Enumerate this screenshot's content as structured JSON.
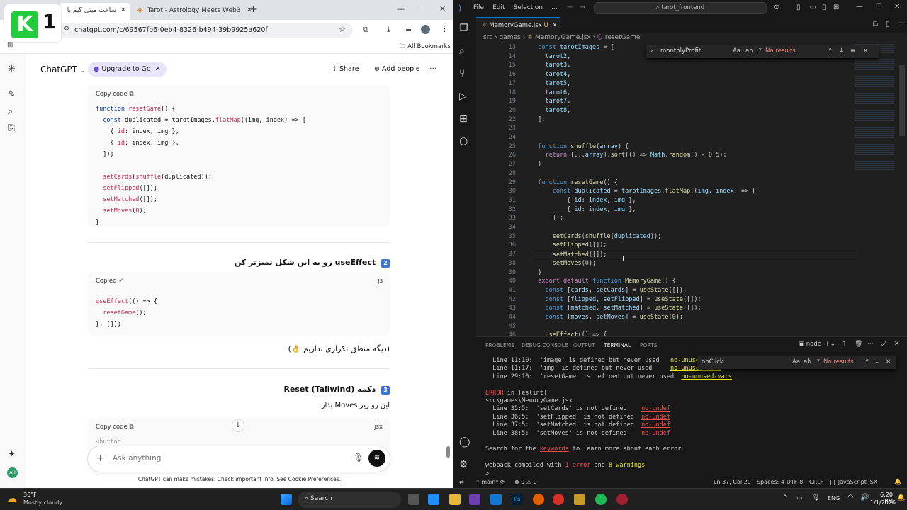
{
  "browser": {
    "tabs": [
      {
        "label": "ساخت میتی گیم با React"
      },
      {
        "label": "Tarot - Astrology Meets Web3"
      }
    ],
    "new_tab": "+",
    "url": "chatgpt.com/c/69567fb6-0eb4-8326-b494-39b9925a620f",
    "all_bookmarks": "All Bookmarks",
    "logo_text": "1"
  },
  "chatgpt": {
    "title": "ChatGPT",
    "upgrade": "Upgrade to Go",
    "share": "Share",
    "add_people": "Add people",
    "input_placeholder": "Ask anything",
    "disclaimer": "ChatGPT can make mistakes. Check important info. See",
    "disclaimer_link": "Cookie Preferences.",
    "code1": {
      "copy": "Copy code",
      "lines": [
        [
          "kw",
          "function "
        ],
        [
          "fn",
          "resetGame"
        ],
        [
          "",
          "() {"
        ],
        "br",
        [
          "",
          "  "
        ],
        [
          "kw",
          "const "
        ],
        [
          "",
          "duplicated = tarotImages."
        ],
        [
          "fn",
          "flatMap"
        ],
        [
          "",
          "((img, index) => ["
        ],
        "br",
        [
          "",
          "    { "
        ],
        [
          "str",
          "id"
        ],
        [
          "",
          ": index, img },"
        ],
        "br",
        [
          "",
          "    { "
        ],
        [
          "str",
          "id"
        ],
        [
          "",
          ": index, img },"
        ],
        "br",
        [
          "",
          "  ]);"
        ],
        "br",
        [
          "",
          ""
        ],
        "br",
        [
          "",
          "  "
        ],
        [
          "fn",
          "setCards"
        ],
        [
          "",
          "("
        ],
        [
          "fn",
          "shuffle"
        ],
        [
          "",
          "(duplicated));"
        ],
        "br",
        [
          "",
          "  "
        ],
        [
          "fn",
          "setFlipped"
        ],
        [
          "",
          "([]);"
        ],
        "br",
        [
          "",
          "  "
        ],
        [
          "fn",
          "setMatched"
        ],
        [
          "",
          "([]);"
        ],
        "br",
        [
          "",
          "  "
        ],
        [
          "fn",
          "setMoves"
        ],
        [
          "",
          "("
        ],
        [
          "str",
          "0"
        ],
        [
          "",
          ");"
        ],
        "br",
        [
          "",
          "}"
        ]
      ]
    },
    "heading2": "useEffect رو به این شکل تمیزتر کن",
    "badge2": "2",
    "code2": {
      "copy": "Copied ✓",
      "lang": "js",
      "lines": [
        [
          [
            "fn",
            "useEffect"
          ],
          [
            "",
            "(() => {"
          ]
        ],
        [
          [
            "",
            "  "
          ],
          [
            "fn",
            "resetGame"
          ],
          [
            "",
            "();"
          ]
        ],
        [
          [
            "",
            "}, []);"
          ]
        ]
      ]
    },
    "note": "(دیگه منطق تکراری نداریم 👌)",
    "heading3": "دکمه Reset (Tailwind)",
    "badge3": "3",
    "para3": "این رو زیر Moves بذار:",
    "code3": {
      "copy": "Copy code",
      "lang": "jsx",
      "peek": "<button"
    }
  },
  "vscode": {
    "menu": [
      "File",
      "Edit",
      "Selection",
      "..."
    ],
    "search": "tarot_frontend",
    "tab": "MemoryGame.jsx",
    "tab_status": "U",
    "breadcrumb": [
      "src",
      "games",
      "MemoryGame.jsx",
      "resetGame"
    ],
    "find1": {
      "value": "monthlyProfit",
      "result": "No results"
    },
    "find2": {
      "value": "onClick",
      "result": "No results"
    },
    "editor_lines": [
      {
        "n": "13",
        "t": [
          [
            "o",
            "  "
          ],
          [
            "k",
            "const "
          ],
          [
            "v",
            "tarotImages"
          ],
          [
            "o",
            " = ["
          ]
        ]
      },
      {
        "n": "14",
        "t": [
          [
            "v",
            "    tarot2"
          ],
          [
            "o",
            ","
          ]
        ]
      },
      {
        "n": "15",
        "t": [
          [
            "v",
            "    tarot3"
          ],
          [
            "o",
            ","
          ]
        ]
      },
      {
        "n": "16",
        "t": [
          [
            "v",
            "    tarot4"
          ],
          [
            "o",
            ","
          ]
        ]
      },
      {
        "n": "17",
        "t": [
          [
            "v",
            "    tarot5"
          ],
          [
            "o",
            ","
          ]
        ]
      },
      {
        "n": "18",
        "t": [
          [
            "v",
            "    tarot6"
          ],
          [
            "o",
            ","
          ]
        ]
      },
      {
        "n": "19",
        "t": [
          [
            "v",
            "    tarot7"
          ],
          [
            "o",
            ","
          ]
        ]
      },
      {
        "n": "20",
        "t": [
          [
            "v",
            "    tarot8"
          ],
          [
            "o",
            ","
          ]
        ]
      },
      {
        "n": "22",
        "t": [
          [
            "o",
            "  ];"
          ]
        ]
      },
      {
        "n": "23",
        "t": []
      },
      {
        "n": "24",
        "t": []
      },
      {
        "n": "25",
        "t": [
          [
            "k",
            "  function "
          ],
          [
            "f",
            "shuffle"
          ],
          [
            "o",
            "("
          ],
          [
            "v",
            "array"
          ],
          [
            "o",
            ") {"
          ]
        ]
      },
      {
        "n": "26",
        "t": [
          [
            "p",
            "    return "
          ],
          [
            "o",
            "[..."
          ],
          [
            "v",
            "array"
          ],
          [
            "o",
            "]."
          ],
          [
            "f",
            "sort"
          ],
          [
            "o",
            "(() => "
          ],
          [
            "v",
            "Math"
          ],
          [
            "o",
            "."
          ],
          [
            "f",
            "random"
          ],
          [
            "o",
            "() - "
          ],
          [
            "n",
            "0.5"
          ],
          [
            "o",
            ");"
          ]
        ]
      },
      {
        "n": "27",
        "t": [
          [
            "o",
            "  }"
          ]
        ]
      },
      {
        "n": "28",
        "t": []
      },
      {
        "n": "29",
        "t": [
          [
            "k",
            "  function "
          ],
          [
            "f",
            "resetGame"
          ],
          [
            "o",
            "() {"
          ]
        ]
      },
      {
        "n": "30",
        "t": [
          [
            "k",
            "      const "
          ],
          [
            "v",
            "duplicated"
          ],
          [
            "o",
            " = "
          ],
          [
            "v",
            "tarotImages"
          ],
          [
            "o",
            "."
          ],
          [
            "f",
            "flatMap"
          ],
          [
            "o",
            "(("
          ],
          [
            "v",
            "img"
          ],
          [
            "o",
            ", "
          ],
          [
            "v",
            "index"
          ],
          [
            "o",
            ") => ["
          ]
        ]
      },
      {
        "n": "31",
        "t": [
          [
            "o",
            "          { "
          ],
          [
            "v",
            "id"
          ],
          [
            "o",
            ": "
          ],
          [
            "v",
            "index"
          ],
          [
            "o",
            ", "
          ],
          [
            "v",
            "img"
          ],
          [
            "o",
            " },"
          ]
        ]
      },
      {
        "n": "32",
        "t": [
          [
            "o",
            "          { "
          ],
          [
            "v",
            "id"
          ],
          [
            "o",
            ": "
          ],
          [
            "v",
            "index"
          ],
          [
            "o",
            ", "
          ],
          [
            "v",
            "img"
          ],
          [
            "o",
            " },"
          ]
        ]
      },
      {
        "n": "33",
        "t": [
          [
            "o",
            "      ]);"
          ]
        ]
      },
      {
        "n": "34",
        "t": []
      },
      {
        "n": "35",
        "t": [
          [
            "f",
            "      setCards"
          ],
          [
            "o",
            "("
          ],
          [
            "f",
            "shuffle"
          ],
          [
            "o",
            "("
          ],
          [
            "v",
            "duplicated"
          ],
          [
            "o",
            "));"
          ]
        ]
      },
      {
        "n": "36",
        "t": [
          [
            "f",
            "      setFlipped"
          ],
          [
            "o",
            "([]);"
          ]
        ]
      },
      {
        "n": "37",
        "t": [
          [
            "f",
            "      setMatched"
          ],
          [
            "o",
            "([]);"
          ]
        ]
      },
      {
        "n": "38",
        "t": [
          [
            "f",
            "      setMoves"
          ],
          [
            "o",
            "("
          ],
          [
            "n",
            "0"
          ],
          [
            "o",
            ");"
          ]
        ]
      },
      {
        "n": "39",
        "t": [
          [
            "o",
            "  }"
          ]
        ]
      },
      {
        "n": "40",
        "t": [
          [
            "p",
            "  export default "
          ],
          [
            "k",
            "function "
          ],
          [
            "f",
            "MemoryGame"
          ],
          [
            "o",
            "() {"
          ]
        ]
      },
      {
        "n": "41",
        "t": [
          [
            "k",
            "    const "
          ],
          [
            "o",
            "["
          ],
          [
            "v",
            "cards"
          ],
          [
            "o",
            ", "
          ],
          [
            "v",
            "setCards"
          ],
          [
            "o",
            "] = "
          ],
          [
            "f",
            "useState"
          ],
          [
            "o",
            "([]);"
          ]
        ]
      },
      {
        "n": "42",
        "t": [
          [
            "k",
            "    const "
          ],
          [
            "o",
            "["
          ],
          [
            "v",
            "flipped"
          ],
          [
            "o",
            ", "
          ],
          [
            "v",
            "setFlipped"
          ],
          [
            "o",
            "] = "
          ],
          [
            "f",
            "useState"
          ],
          [
            "o",
            "([]);"
          ]
        ]
      },
      {
        "n": "43",
        "t": [
          [
            "k",
            "    const "
          ],
          [
            "o",
            "["
          ],
          [
            "v",
            "matched"
          ],
          [
            "o",
            ", "
          ],
          [
            "v",
            "setMatched"
          ],
          [
            "o",
            "] = "
          ],
          [
            "f",
            "useState"
          ],
          [
            "o",
            "([]);"
          ]
        ]
      },
      {
        "n": "44",
        "t": [
          [
            "k",
            "    const "
          ],
          [
            "o",
            "["
          ],
          [
            "v",
            "moves"
          ],
          [
            "o",
            ", "
          ],
          [
            "v",
            "setMoves"
          ],
          [
            "o",
            "] = "
          ],
          [
            "f",
            "useState"
          ],
          [
            "o",
            "("
          ],
          [
            "n",
            "0"
          ],
          [
            "o",
            ");"
          ]
        ]
      },
      {
        "n": "45",
        "t": []
      },
      {
        "n": "46",
        "t": [
          [
            "f",
            "    useEffect"
          ],
          [
            "o",
            "(() => {"
          ]
        ]
      }
    ],
    "panel_tabs": [
      "PROBLEMS",
      "DEBUG CONSOLE",
      "OUTPUT",
      "TERMINAL",
      "PORTS"
    ],
    "panel_shell": "node",
    "terminal": [
      [
        [
          "",
          "  Line 11:10:  'image' is defined but never used   "
        ],
        [
          "yel ul",
          "no-unused-vars"
        ]
      ],
      [
        [
          "",
          "  Line 11:17:  'img' is defined but never used     "
        ],
        [
          "yel ul",
          "no-unused-vars"
        ]
      ],
      [
        [
          "",
          "  Line 29:10:  'resetGame' is defined but never used  "
        ],
        [
          "yel ul",
          "no-unused-vars"
        ]
      ],
      [
        [
          "",
          ""
        ]
      ],
      [
        [
          "red",
          "ERROR"
        ],
        [
          "",
          " in [eslint]"
        ]
      ],
      [
        [
          "",
          "src\\games\\MemoryGame.jsx"
        ]
      ],
      [
        [
          "",
          "  Line 35:5:  'setCards' is not defined    "
        ],
        [
          "red ul",
          "no-undef"
        ]
      ],
      [
        [
          "",
          "  Line 36:5:  'setFlipped' is not defined  "
        ],
        [
          "red ul",
          "no-undef"
        ]
      ],
      [
        [
          "",
          "  Line 37:5:  'setMatched' is not defined  "
        ],
        [
          "red ul",
          "no-undef"
        ]
      ],
      [
        [
          "",
          "  Line 38:5:  'setMoves' is not defined    "
        ],
        [
          "red ul",
          "no-undef"
        ]
      ],
      [
        [
          "",
          ""
        ]
      ],
      [
        [
          "",
          "Search for the "
        ],
        [
          "red ul",
          "keywords"
        ],
        [
          "",
          " to learn more about each error."
        ]
      ],
      [
        [
          "",
          ""
        ]
      ],
      [
        [
          "",
          "webpack compiled with "
        ],
        [
          "red",
          "1 error"
        ],
        [
          "",
          " and "
        ],
        [
          "yel",
          "8 warnings"
        ]
      ],
      [
        [
          "",
          ">"
        ]
      ]
    ],
    "status": {
      "branch": "main*",
      "errors": "0",
      "warnings": "0",
      "cursor": "Ln 37, Col 20",
      "spaces": "Spaces: 4",
      "encoding": "UTF-8",
      "eol": "CRLF",
      "language": "JavaScript JSX"
    }
  },
  "taskbar": {
    "weather_temp": "36°F",
    "weather_desc": "Mostly cloudy",
    "search": "Search",
    "lang": "ENG",
    "time": "6:20 PM",
    "date": "1/1/2026"
  }
}
